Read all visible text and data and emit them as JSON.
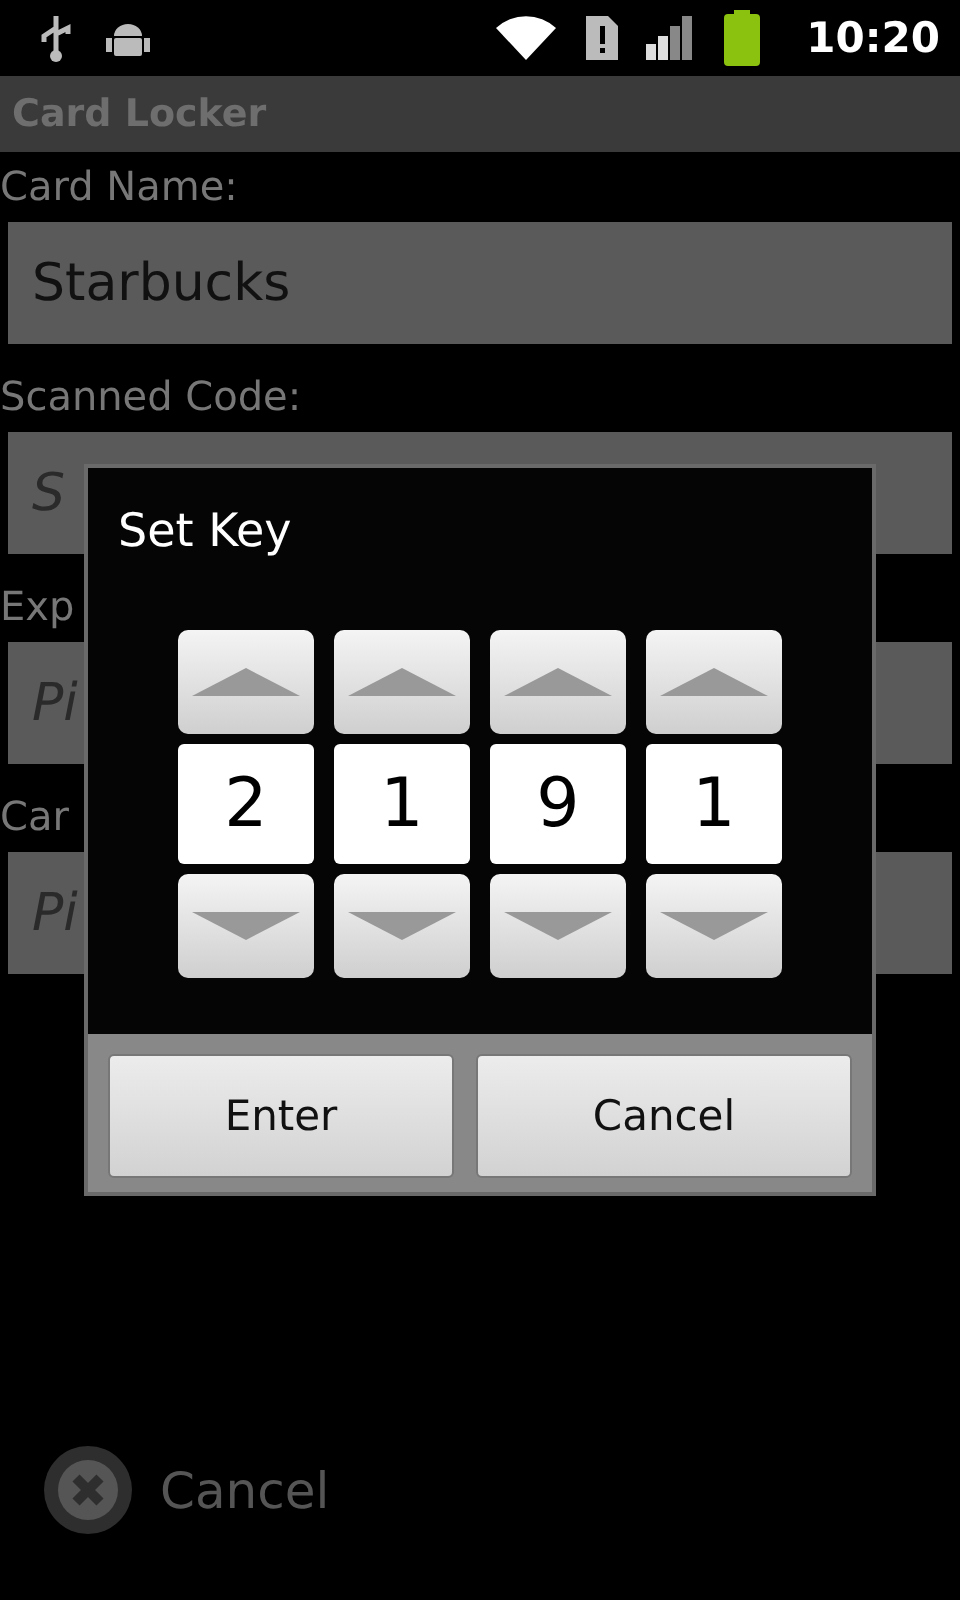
{
  "status_bar": {
    "time": "10:20"
  },
  "app_title": "Card Locker",
  "form": [
    {
      "label": "Card Name:",
      "value": "Starbucks"
    },
    {
      "label": "Scanned Code:",
      "placeholder": "S"
    },
    {
      "label": "Exp",
      "placeholder": "Pi"
    },
    {
      "label": "Car",
      "placeholder": "Pi"
    }
  ],
  "dialog": {
    "title": "Set Key",
    "digits": [
      "2",
      "1",
      "9",
      "1"
    ],
    "buttons": [
      "Enter",
      "Cancel"
    ]
  },
  "bottom_button": "Cancel"
}
